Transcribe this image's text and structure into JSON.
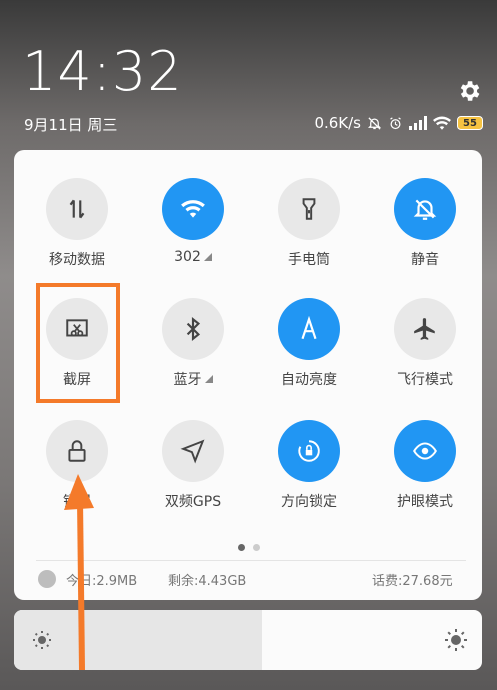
{
  "status": {
    "time": "14:32",
    "date": "9月11日 周三",
    "network_speed": "0.6K/s",
    "battery": "55"
  },
  "tiles": [
    {
      "label": "移动数据",
      "icon": "mobile-data-icon",
      "on": false,
      "triangle": false
    },
    {
      "label": "302",
      "icon": "wifi-icon",
      "on": true,
      "triangle": true
    },
    {
      "label": "手电筒",
      "icon": "flashlight-icon",
      "on": false,
      "triangle": false
    },
    {
      "label": "静音",
      "icon": "mute-bell-icon",
      "on": true,
      "triangle": false
    },
    {
      "label": "截屏",
      "icon": "screenshot-icon",
      "on": false,
      "triangle": false
    },
    {
      "label": "蓝牙",
      "icon": "bluetooth-icon",
      "on": false,
      "triangle": true
    },
    {
      "label": "自动亮度",
      "icon": "auto-brightness-icon",
      "on": true,
      "triangle": false
    },
    {
      "label": "飞行模式",
      "icon": "airplane-icon",
      "on": false,
      "triangle": false
    },
    {
      "label": "锁屏",
      "icon": "lock-icon",
      "on": false,
      "triangle": false
    },
    {
      "label": "双频GPS",
      "icon": "gps-icon",
      "on": false,
      "triangle": false
    },
    {
      "label": "方向锁定",
      "icon": "rotation-lock-icon",
      "on": true,
      "triangle": false
    },
    {
      "label": "护眼模式",
      "icon": "eye-icon",
      "on": true,
      "triangle": false
    }
  ],
  "usage": {
    "today": "今日:2.9MB",
    "remaining": "剩余:4.43GB",
    "fee": "话费:27.68元"
  },
  "brightness": {
    "level": 0.53
  },
  "colors": {
    "accent": "#2196f3",
    "highlight": "#f47a2a"
  }
}
